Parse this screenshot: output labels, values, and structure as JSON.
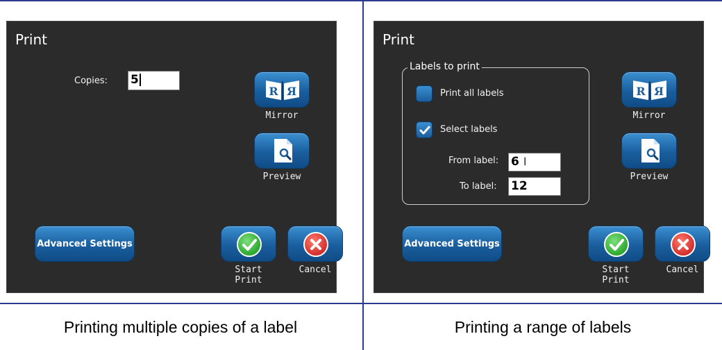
{
  "left_panel": {
    "title": "Print",
    "copies_label": "Copies:",
    "copies_value": "5",
    "mirror_label": "Mirror",
    "preview_label": "Preview",
    "advanced_label": "Advanced Settings",
    "start_label_1": "Start",
    "start_label_2": "Print",
    "cancel_label": "Cancel",
    "mirror_glyph_left": "R",
    "mirror_glyph_right": "Я"
  },
  "right_panel": {
    "title": "Print",
    "group_title": "Labels to print",
    "print_all_label": "Print all labels",
    "print_all_checked": false,
    "select_labels_label": "Select labels",
    "select_labels_checked": true,
    "from_label": "From label:",
    "from_value": "6",
    "to_label": "To label:",
    "to_value": "12",
    "mirror_label": "Mirror",
    "preview_label": "Preview",
    "advanced_label": "Advanced Settings",
    "start_label_1": "Start",
    "start_label_2": "Print",
    "cancel_label": "Cancel",
    "mirror_glyph_left": "R",
    "mirror_glyph_right": "Я"
  },
  "captions": {
    "left": "Printing multiple copies of a label",
    "right": "Printing a range of labels"
  },
  "colors": {
    "rule": "#2b3a8f",
    "panel_bg": "#2b2b2b",
    "button_blue": "#1a5e9e",
    "ok_green": "#2ea82e",
    "cancel_red": "#d32f2f"
  },
  "icons": {
    "mirror": "mirror-icon",
    "preview": "preview-icon",
    "start_print": "check-circle-icon",
    "cancel": "x-circle-icon",
    "checkbox_checked": "checkmark-icon"
  }
}
